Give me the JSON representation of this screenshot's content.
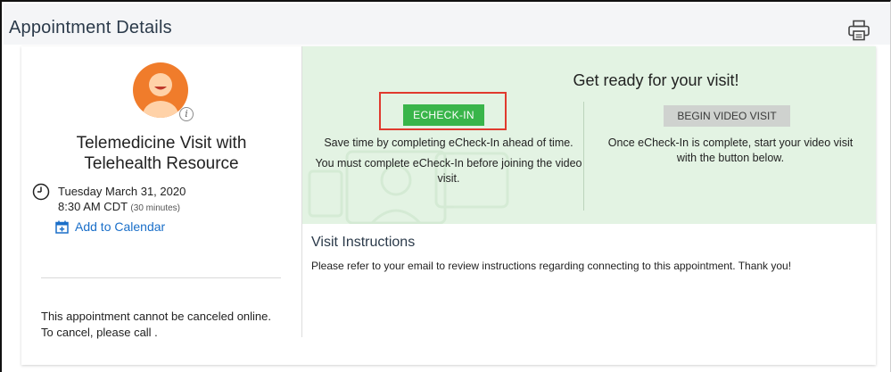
{
  "header": {
    "title": "Appointment Details",
    "print_icon": "printer-icon"
  },
  "appointment": {
    "avatar_icon": "provider-avatar-icon",
    "info_badge": "i",
    "title": "Telemedicine Visit with Telehealth Resource",
    "date": "Tuesday March 31, 2020",
    "time": "8:30 AM CDT",
    "duration": "(30 minutes)",
    "add_to_calendar": "Add to Calendar",
    "cancel_note": "This appointment cannot be canceled online. To cancel, please call ."
  },
  "ready": {
    "title": "Get ready for your visit!",
    "echeckin_label": "ECHECK-IN",
    "echeckin_text_1": "Save time by completing eCheck-In ahead of time.",
    "echeckin_text_2": "You must complete eCheck-In before joining the video visit.",
    "video_label": "BEGIN VIDEO VISIT",
    "video_text": "Once eCheck-In is complete, start your video visit with the button below."
  },
  "instructions": {
    "title": "Visit Instructions",
    "text": "Please refer to your email to review instructions regarding connecting to this appointment. Thank you!"
  },
  "colors": {
    "echeckin_button": "#39b54a",
    "highlight_box": "#e03a2e",
    "ready_panel_bg": "#e3f3e3",
    "avatar_bg": "#f07c2b",
    "link": "#1a6fc9"
  }
}
